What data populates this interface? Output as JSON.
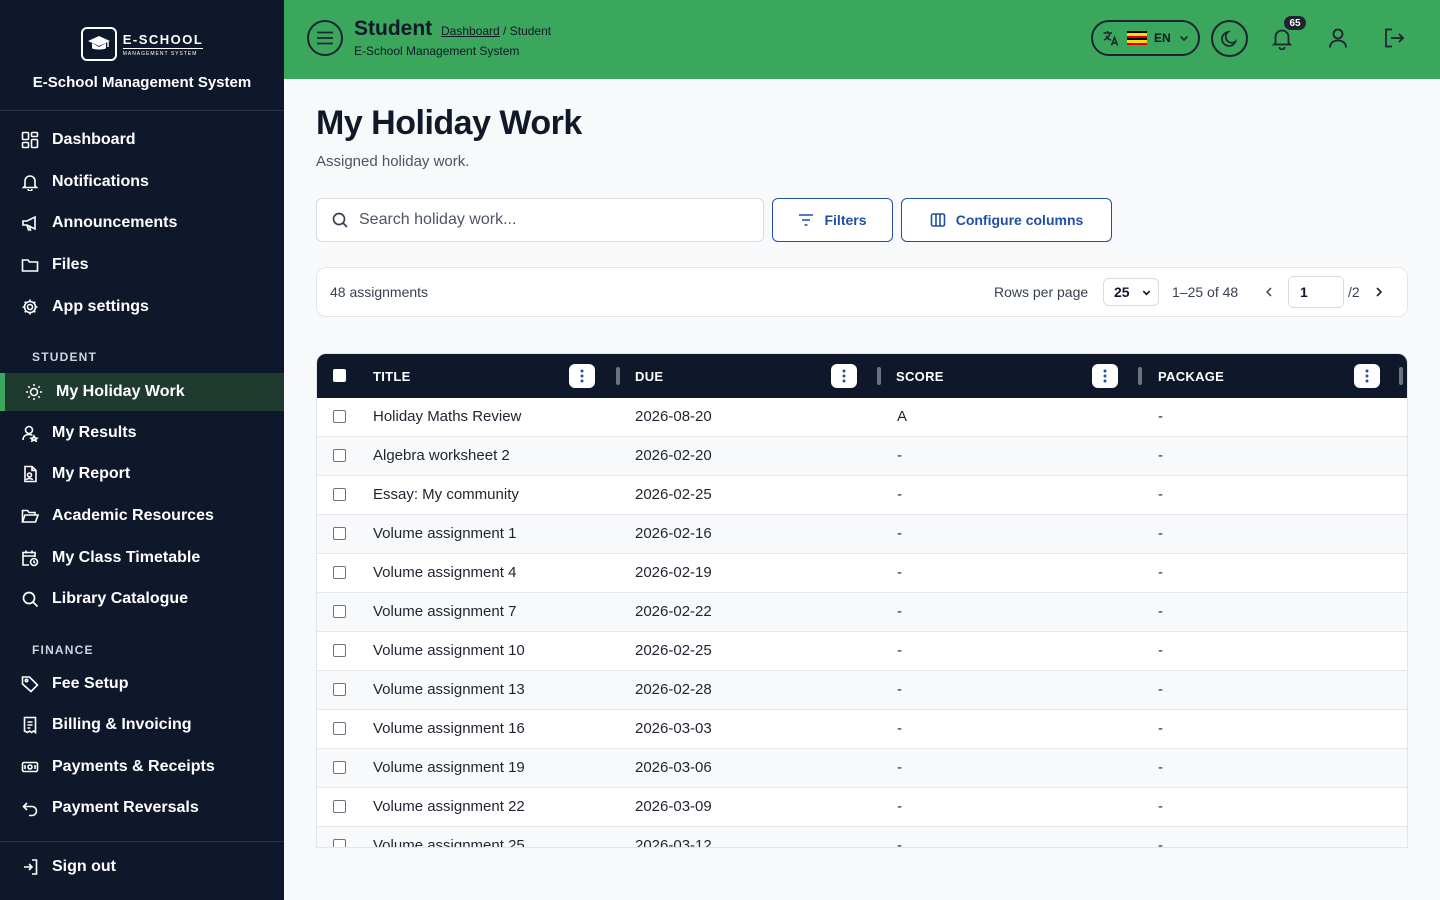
{
  "brand": {
    "logo_title": "E-SCHOOL",
    "logo_sub": "MANAGEMENT SYSTEM",
    "name": "E-School Management System"
  },
  "sidebar": {
    "items_top": [
      {
        "label": "Dashboard",
        "icon": "dashboard-icon"
      },
      {
        "label": "Notifications",
        "icon": "bell-icon"
      },
      {
        "label": "Announcements",
        "icon": "megaphone-icon"
      },
      {
        "label": "Files",
        "icon": "folder-icon"
      },
      {
        "label": "App settings",
        "icon": "gear-icon"
      }
    ],
    "section_student": "STUDENT",
    "items_student": [
      {
        "label": "My Holiday Work",
        "icon": "sun-icon"
      },
      {
        "label": "My Results",
        "icon": "user-award-icon"
      },
      {
        "label": "My Report",
        "icon": "report-icon"
      },
      {
        "label": "Academic Resources",
        "icon": "folder-open-icon"
      },
      {
        "label": "My Class Timetable",
        "icon": "calendar-clock-icon"
      },
      {
        "label": "Library Catalogue",
        "icon": "search-icon"
      }
    ],
    "section_finance": "FINANCE",
    "items_finance": [
      {
        "label": "Fee Setup",
        "icon": "tag-icon"
      },
      {
        "label": "Billing & Invoicing",
        "icon": "invoice-icon"
      },
      {
        "label": "Payments & Receipts",
        "icon": "money-icon"
      },
      {
        "label": "Payment Reversals",
        "icon": "undo-icon"
      }
    ],
    "sign_out": "Sign out",
    "active": "My Holiday Work"
  },
  "header": {
    "title": "Student",
    "breadcrumb_link": "Dashboard",
    "breadcrumb_sep": " / ",
    "breadcrumb_current": "Student",
    "subtitle": "E-School Management System",
    "lang_code": "EN",
    "notification_count": "65",
    "accent": "#3aa75c"
  },
  "page": {
    "title": "My Holiday Work",
    "subtitle": "Assigned holiday work.",
    "search_placeholder": "Search holiday work...",
    "filters_label": "Filters",
    "configure_label": "Configure columns"
  },
  "pager": {
    "count": "48 assignments",
    "rows_per_page_label": "Rows per page",
    "rows_per_page": "25",
    "range": "1–25 of 48",
    "page": "1",
    "total_pages": "/2"
  },
  "table": {
    "columns": [
      "TITLE",
      "DUE",
      "SCORE",
      "PACKAGE"
    ],
    "rows": [
      {
        "title": "Holiday Maths Review",
        "due": "2026-08-20",
        "score": "A",
        "package": "-"
      },
      {
        "title": "Algebra worksheet 2",
        "due": "2026-02-20",
        "score": "-",
        "package": "-"
      },
      {
        "title": "Essay: My community",
        "due": "2026-02-25",
        "score": "-",
        "package": "-"
      },
      {
        "title": "Volume assignment 1",
        "due": "2026-02-16",
        "score": "-",
        "package": "-"
      },
      {
        "title": "Volume assignment 4",
        "due": "2026-02-19",
        "score": "-",
        "package": "-"
      },
      {
        "title": "Volume assignment 7",
        "due": "2026-02-22",
        "score": "-",
        "package": "-"
      },
      {
        "title": "Volume assignment 10",
        "due": "2026-02-25",
        "score": "-",
        "package": "-"
      },
      {
        "title": "Volume assignment 13",
        "due": "2026-02-28",
        "score": "-",
        "package": "-"
      },
      {
        "title": "Volume assignment 16",
        "due": "2026-03-03",
        "score": "-",
        "package": "-"
      },
      {
        "title": "Volume assignment 19",
        "due": "2026-03-06",
        "score": "-",
        "package": "-"
      },
      {
        "title": "Volume assignment 22",
        "due": "2026-03-09",
        "score": "-",
        "package": "-"
      },
      {
        "title": "Volume assignment 25",
        "due": "2026-03-12",
        "score": "-",
        "package": "-"
      }
    ]
  }
}
